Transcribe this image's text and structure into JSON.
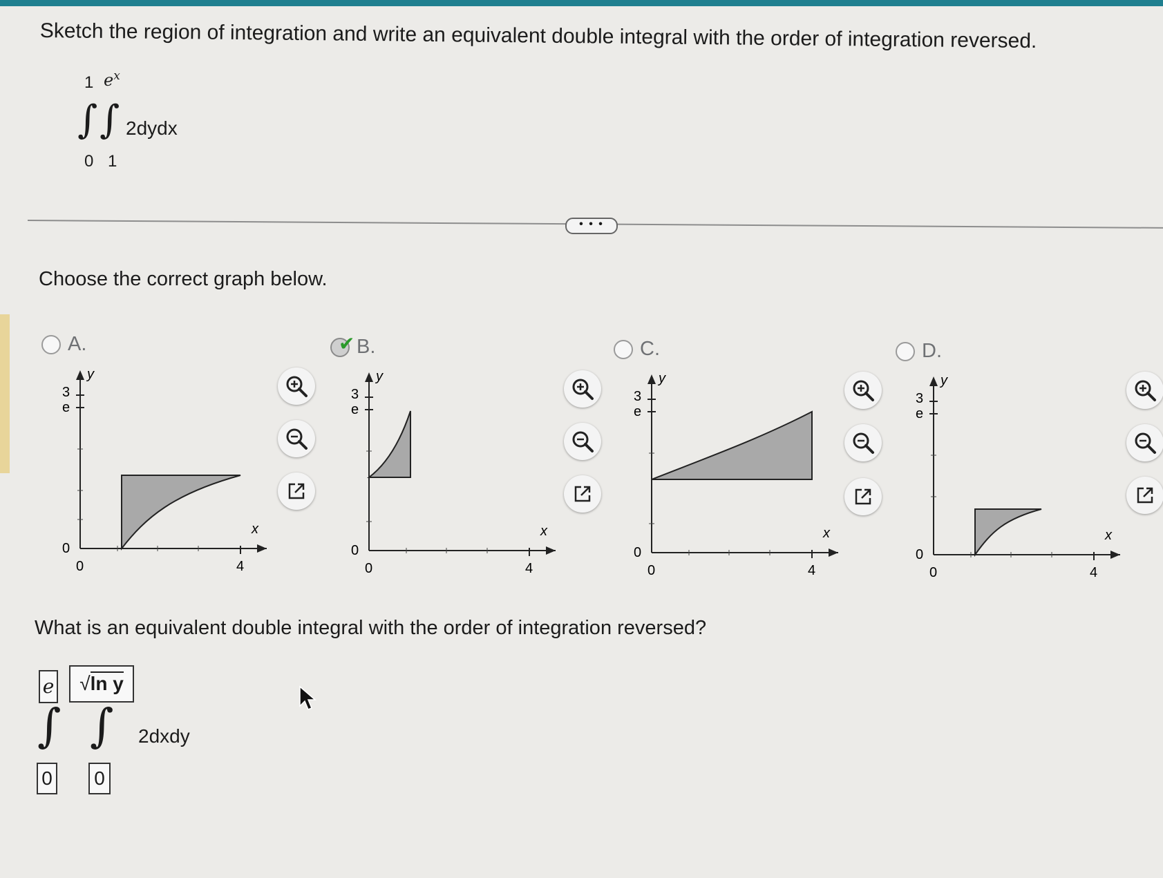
{
  "question": "Sketch the region of integration and write an equivalent double integral with the order of integration reversed.",
  "given_integral": {
    "outer_lower": "0",
    "outer_upper": "1",
    "inner_lower": "1",
    "inner_upper_base": "e",
    "inner_upper_sup": "x",
    "integrand": "2dydx"
  },
  "more_button_label": "• • •",
  "choose_prompt": "Choose the correct graph below.",
  "options": [
    {
      "letter": "A.",
      "selected": false
    },
    {
      "letter": "B.",
      "selected": true
    },
    {
      "letter": "C.",
      "selected": false
    },
    {
      "letter": "D.",
      "selected": false
    }
  ],
  "graph_labels": {
    "y_axis": "y",
    "x_axis": "x",
    "tick_3": "3",
    "tick_e": "e",
    "tick_0": "0",
    "x_zero": "0",
    "x_four": "4"
  },
  "icons": [
    "zoom-in-icon",
    "zoom-out-icon",
    "open-new-window-icon"
  ],
  "reversed_prompt": "What is an equivalent double integral with the order of integration reversed?",
  "answer": {
    "outer_upper": "e",
    "outer_lower": "0",
    "inner_upper": "ln y",
    "inner_lower": "0",
    "integrand": "2dxdy"
  },
  "colors": {
    "region_fill": "#a9a9a9",
    "accent_check": "#2b9a2b",
    "top_bar": "#1f7f8f"
  }
}
